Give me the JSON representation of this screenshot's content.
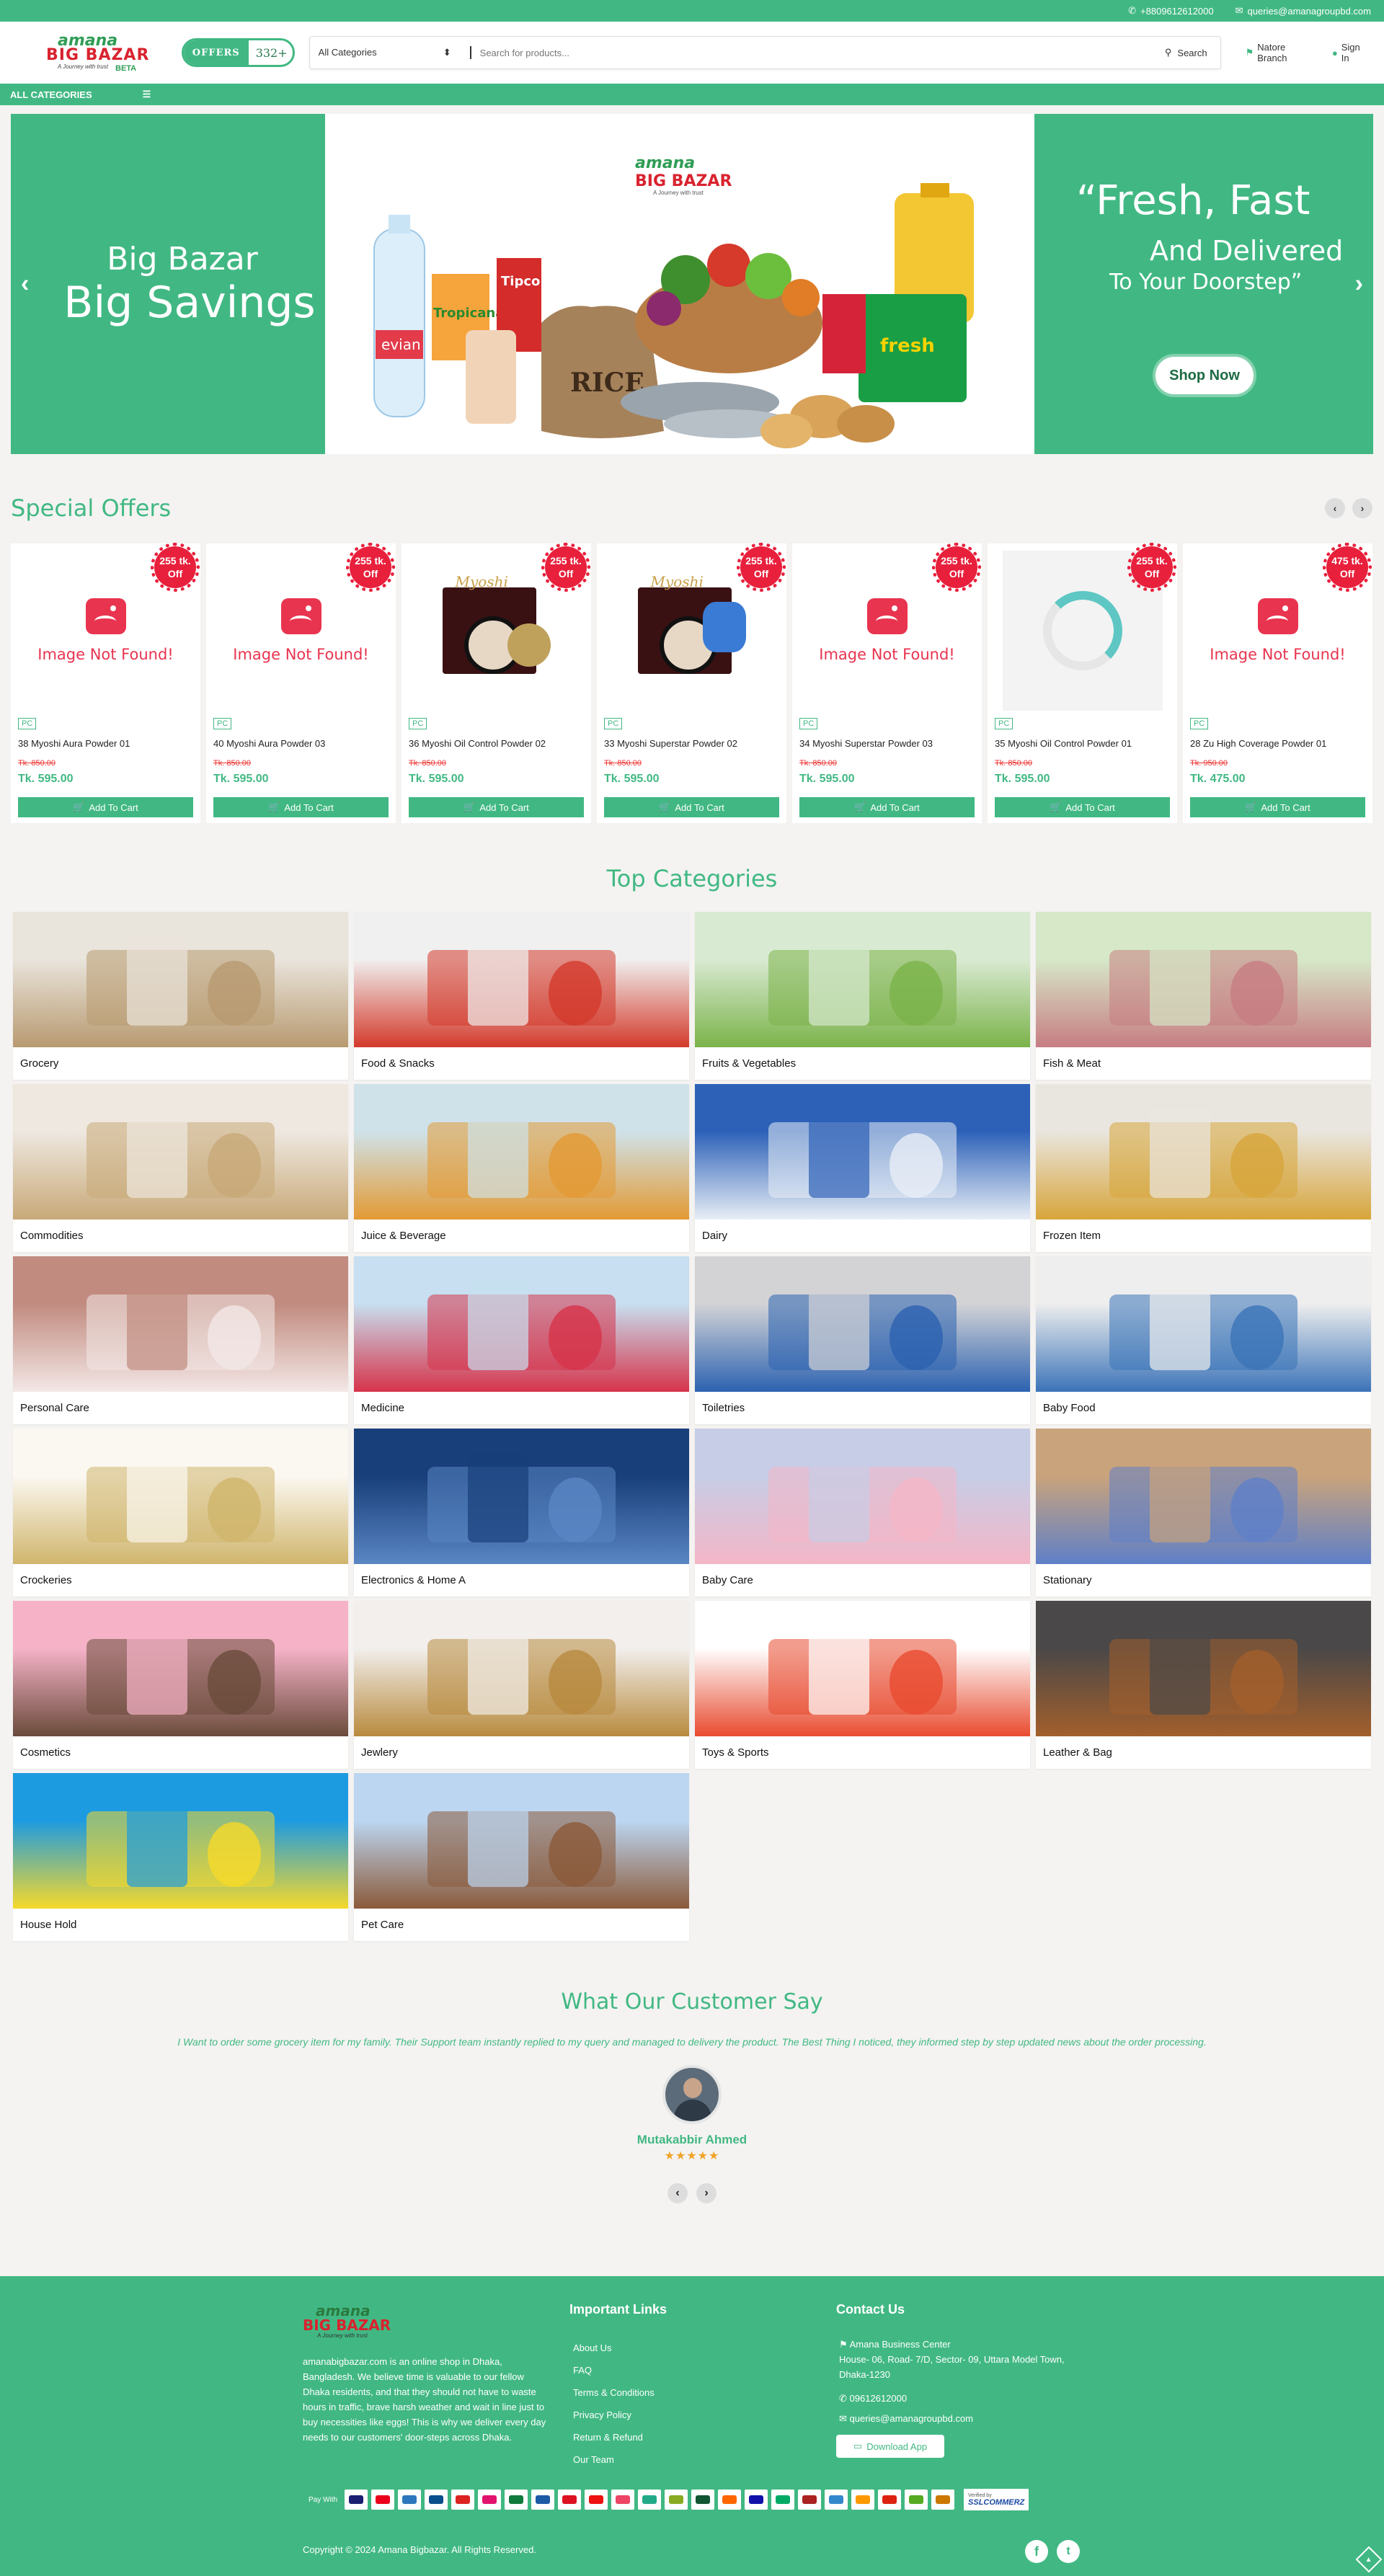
{
  "topbar": {
    "phone": "+8809612612000",
    "email": "queries@amanagroupbd.com"
  },
  "logo": {
    "line1": "amana",
    "line2": "BIG BAZAR",
    "tagline": "A Journey with trust",
    "beta": "BETA"
  },
  "offers": {
    "label": "OFFERS",
    "count": "332+"
  },
  "search": {
    "category": "All Categories",
    "placeholder": "Search for products...",
    "button": "Search"
  },
  "header": {
    "branch": "Natore Branch",
    "signin": "Sign In"
  },
  "catbar": {
    "label": "ALL CATEGORIES"
  },
  "hero": {
    "left_line1": "Big Bazar",
    "left_line2": "Big Savings",
    "right_line1": "“Fresh, Fast",
    "right_line2": "And Delivered",
    "right_line3": "To Your Doorstep”",
    "cta": "Shop Now",
    "center_logo1": "amana",
    "center_logo2": "BIG BAZAR",
    "center_tagline": "A Journey with trust",
    "sack_label": "RICE",
    "bottle_label": "evian",
    "juice_label": "Tropicana",
    "salt_label": "fresh",
    "tipco_label": "Tipco"
  },
  "special_offers": {
    "title": "Special Offers",
    "not_found": "Image Not Found!",
    "tag": "PC",
    "add_to_cart": "Add To Cart",
    "off": "Off",
    "items": [
      {
        "discount": "255 tk.",
        "name": "38 Myoshi Aura Powder 01",
        "old": "Tk. 850.00",
        "price": "Tk. 595.00",
        "img": "none"
      },
      {
        "discount": "255 tk.",
        "name": "40 Myoshi Aura Powder 03",
        "old": "Tk. 850.00",
        "price": "Tk. 595.00",
        "img": "none"
      },
      {
        "discount": "255 tk.",
        "name": "36 Myoshi Oil Control Powder 02",
        "old": "Tk. 850.00",
        "price": "Tk. 595.00",
        "img": "compact"
      },
      {
        "discount": "255 tk.",
        "name": "33 Myoshi Superstar Powder 02",
        "old": "Tk. 850.00",
        "price": "Tk. 595.00",
        "img": "compact2"
      },
      {
        "discount": "255 tk.",
        "name": "34 Myoshi Superstar Powder 03",
        "old": "Tk. 850.00",
        "price": "Tk. 595.00",
        "img": "none"
      },
      {
        "discount": "255 tk.",
        "name": "35 Myoshi Oil Control Powder 01",
        "old": "Tk. 850.00",
        "price": "Tk. 595.00",
        "img": "loading"
      },
      {
        "discount": "475 tk.",
        "name": "28 Zu High Coverage Powder 01",
        "old": "Tk. 950.00",
        "price": "Tk. 475.00",
        "img": "none"
      }
    ],
    "compact_brand": "Myoshi"
  },
  "top_categories": {
    "title": "Top Categories",
    "items": [
      {
        "label": "Grocery",
        "bg1": "#e9e4dc",
        "bg2": "#b89a70"
      },
      {
        "label": "Food & Snacks",
        "bg1": "#f0f0f0",
        "bg2": "#d33a2c"
      },
      {
        "label": "Fruits & Vegetables",
        "bg1": "#d9ead2",
        "bg2": "#7bb34a"
      },
      {
        "label": "Fish & Meat",
        "bg1": "#d6e8c8",
        "bg2": "#c77d82"
      },
      {
        "label": "Commodities",
        "bg1": "#eee8e0",
        "bg2": "#c8a978"
      },
      {
        "label": "Juice & Beverage",
        "bg1": "#cfe2ea",
        "bg2": "#e39a34"
      },
      {
        "label": "Dairy",
        "bg1": "#2d61b8",
        "bg2": "#e8eef6"
      },
      {
        "label": "Frozen Item",
        "bg1": "#e9e6df",
        "bg2": "#d7a53b"
      },
      {
        "label": "Personal Care",
        "bg1": "#c18b7f",
        "bg2": "#f3e7e6"
      },
      {
        "label": "Medicine",
        "bg1": "#c7dff0",
        "bg2": "#d6334a"
      },
      {
        "label": "Toiletries",
        "bg1": "#d3d3d6",
        "bg2": "#2c62b0"
      },
      {
        "label": "Baby Food",
        "bg1": "#eeeeee",
        "bg2": "#3b74b8"
      },
      {
        "label": "Crockeries",
        "bg1": "#fbf8f1",
        "bg2": "#d0b56c"
      },
      {
        "label": "Electronics & Home A",
        "bg1": "#183f79",
        "bg2": "#5a86c4"
      },
      {
        "label": "Baby Care",
        "bg1": "#c7cde6",
        "bg2": "#f4b6c7"
      },
      {
        "label": "Stationary",
        "bg1": "#c9a37c",
        "bg2": "#5f80c8"
      },
      {
        "label": "Cosmetics",
        "bg1": "#f6b3c8",
        "bg2": "#6a4b3b"
      },
      {
        "label": "Jewlery",
        "bg1": "#f2efed",
        "bg2": "#b88a3e"
      },
      {
        "label": "Toys & Sports",
        "bg1": "#ffffff",
        "bg2": "#e84b2f"
      },
      {
        "label": "Leather & Bag",
        "bg1": "#4a4848",
        "bg2": "#a25f2c"
      },
      {
        "label": "House Hold",
        "bg1": "#1d9be0",
        "bg2": "#f6d92a"
      },
      {
        "label": "Pet Care",
        "bg1": "#bcd6f1",
        "bg2": "#8b5a3a"
      }
    ]
  },
  "testimonial": {
    "title": "What Our Customer Say",
    "quote": "I Want to order some grocery item for my family. Their Support team instantly replied to my query and managed to delivery the product. The Best Thing I noticed, they informed step by step updated news about the order processing.",
    "name": "Mutakabbir Ahmed",
    "stars": "★★★★★"
  },
  "footer": {
    "about": "amanabigbazar.com is an online shop in Dhaka, Bangladesh. We believe time is valuable to our fellow Dhaka residents, and that they should not have to waste hours in traffic, brave harsh weather and wait in line just to buy necessities like eggs! This is why we deliver every day needs to our customers' door-steps across Dhaka.",
    "links_title": "Important Links",
    "links": [
      "About Us",
      "FAQ",
      "Terms & Conditions",
      "Privacy Policy",
      "Return & Refund",
      "Our Team"
    ],
    "contact_title": "Contact Us",
    "address_name": "Amana Business Center",
    "address": "House- 06, Road- 7/D, Sector- 09, Uttara Model Town, Dhaka-1230",
    "phone": "09612612000",
    "email": "queries@amanagroupbd.com",
    "download": "Download App",
    "pay_with": "Pay With",
    "verified": "Verified by",
    "ssl": "SSLCOMMERZ",
    "copyright": "Copyright © 2024 Amana Bigbazar. All Rights Reserved."
  },
  "colors": {
    "brand": "#41b883",
    "accent_red": "#e8203c",
    "logo_red": "#d9232f"
  }
}
